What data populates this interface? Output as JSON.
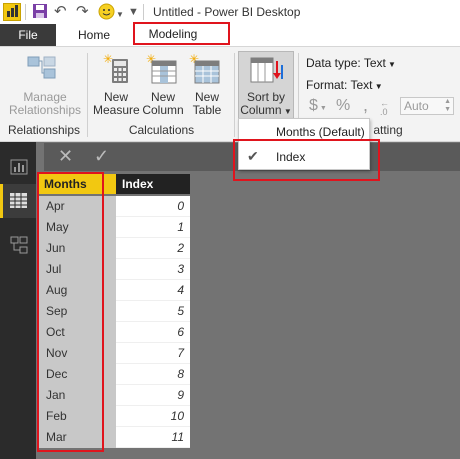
{
  "window": {
    "title": "Untitled - Power BI Desktop"
  },
  "tabs": {
    "file": "File",
    "home": "Home",
    "modeling": "Modeling"
  },
  "ribbon": {
    "relationships": {
      "manage_line1": "Manage",
      "manage_line2": "Relationships",
      "group": "Relationships"
    },
    "calculations": {
      "new_measure_line1": "New",
      "new_measure_line2": "Measure",
      "new_column_line1": "New",
      "new_column_line2": "Column",
      "new_table_line1": "New",
      "new_table_line2": "Table",
      "group": "Calculations"
    },
    "sort": {
      "line1": "Sort by",
      "line2": "Column"
    },
    "formatting": {
      "data_type": "Data type: Text",
      "format": "Format: Text",
      "currency": "$",
      "percent": "%",
      "comma": ",",
      "decimals": "Auto",
      "group_partial": "atting"
    }
  },
  "sort_menu": {
    "items": [
      "Months (Default)",
      "Index"
    ],
    "checked": "Index"
  },
  "table": {
    "columns": [
      "Months",
      "Index"
    ],
    "rows": [
      [
        "Apr",
        "0"
      ],
      [
        "May",
        "1"
      ],
      [
        "Jun",
        "2"
      ],
      [
        "Jul",
        "3"
      ],
      [
        "Aug",
        "4"
      ],
      [
        "Sep",
        "5"
      ],
      [
        "Oct",
        "6"
      ],
      [
        "Nov",
        "7"
      ],
      [
        "Dec",
        "8"
      ],
      [
        "Jan",
        "9"
      ],
      [
        "Feb",
        "10"
      ],
      [
        "Mar",
        "11"
      ]
    ]
  },
  "colors": {
    "accent": "#f2c811",
    "highlight": "#e0141d",
    "file_tab": "#3a3a3a",
    "canvas": "#737373"
  }
}
